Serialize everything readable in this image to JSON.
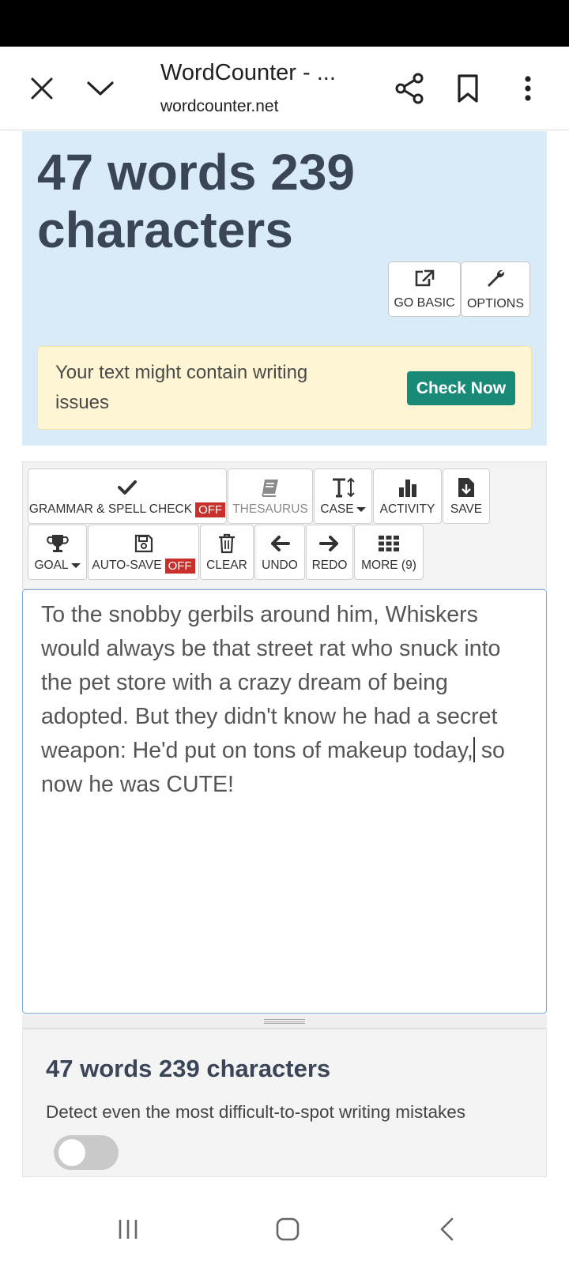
{
  "browser": {
    "title": "WordCounter - ...",
    "url": "wordcounter.net"
  },
  "hero": {
    "count_line1": "47 words 239",
    "count_line2": "characters",
    "go_basic": "GO BASIC",
    "options": "OPTIONS"
  },
  "alert": {
    "text": "Your text might contain writing issues",
    "button": "Check Now"
  },
  "toolbar": {
    "grammar": "GRAMMAR & SPELL CHECK",
    "grammar_state": "OFF",
    "thesaurus": "THESAURUS",
    "case": "CASE",
    "activity": "ACTIVITY",
    "save": "SAVE",
    "goal": "GOAL",
    "autosave": "AUTO-SAVE",
    "autosave_state": "OFF",
    "clear": "CLEAR",
    "undo": "UNDO",
    "redo": "REDO",
    "more": "MORE (9)"
  },
  "editor": {
    "text_before_cursor": "To the snobby gerbils around him, Whiskers would always be that street rat who snuck into the pet store with a crazy dream of being adopted. But they didn't know he had a secret weapon: He'd put on tons of makeup today,",
    "text_after_cursor": " so now he was CUTE!"
  },
  "footer": {
    "count": "47 words 239 characters",
    "description": "Detect even the most difficult-to-spot writing mistakes",
    "toggle_on": false
  },
  "colors": {
    "hero_bg": "#d9ebf7",
    "alert_bg": "#fdf5d4",
    "accent_green": "#1a8a78",
    "off_badge": "#c9302c",
    "heading_text": "#3a4557"
  }
}
